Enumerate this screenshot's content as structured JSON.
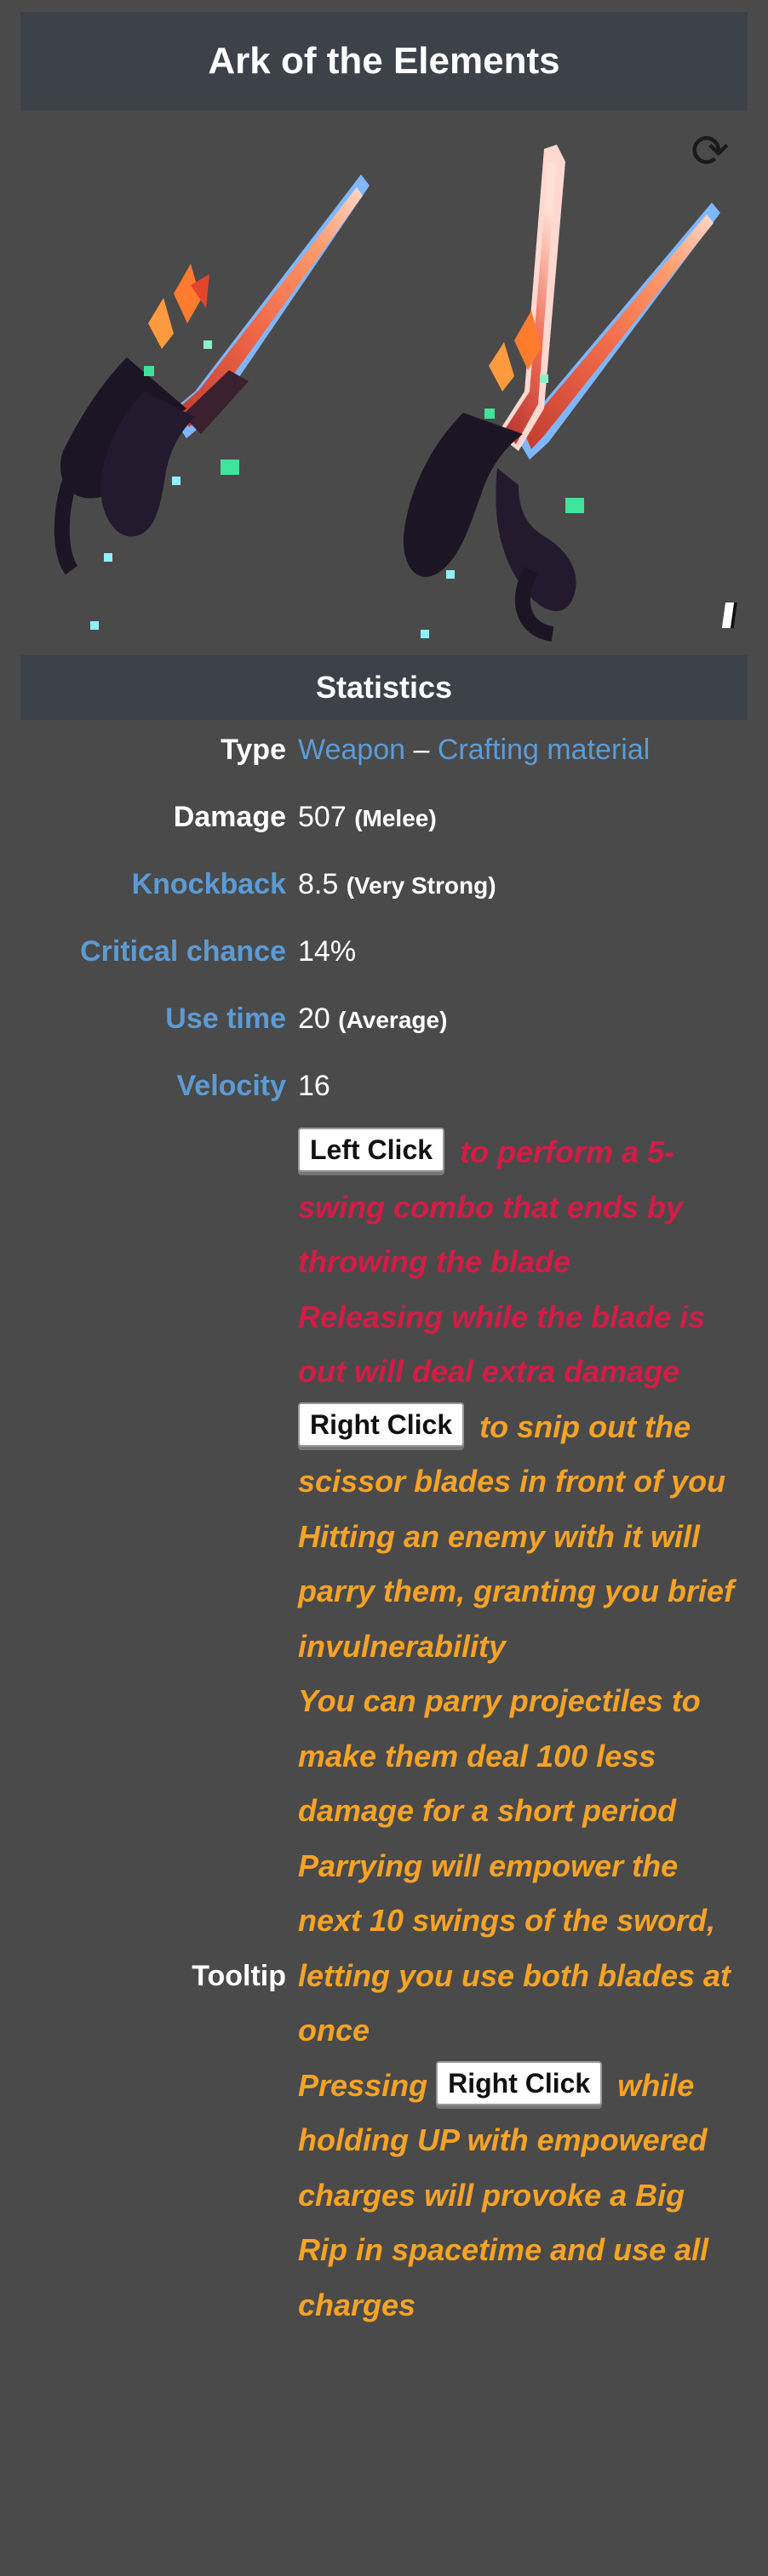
{
  "title": "Ark of the Elements",
  "image": {
    "refresh_icon": "refresh-icon",
    "item_alt": "Ark of the Elements sprite",
    "variants": [
      "closed",
      "open"
    ],
    "colors": {
      "blade_red": "#e24a3b",
      "blade_edge": "#8fc3ff",
      "handle_dark": "#1c1624",
      "gem_green": "#3fe39a",
      "flame_orange": "#ff7b2e"
    }
  },
  "section": "Statistics",
  "stats": {
    "type": {
      "label": "Type",
      "weapon": "Weapon",
      "separator": "–",
      "material": "Crafting material"
    },
    "damage": {
      "label": "Damage",
      "value": "507",
      "note": "(Melee)"
    },
    "knockback": {
      "label": "Knockback",
      "value": "8.5",
      "note": "(Very Strong)"
    },
    "critical": {
      "label": "Critical chance",
      "value": "14%"
    },
    "use_time": {
      "label": "Use time",
      "value": "20",
      "note": "(Average)"
    },
    "velocity": {
      "label": "Velocity",
      "value": "16"
    }
  },
  "tooltip": {
    "label": "Tooltip",
    "left_click": "Left Click",
    "red_line1": "to perform a 5-swing combo that ends by throwing the blade",
    "red_line2": "Releasing while the blade is out will deal extra damage",
    "right_click": "Right Click",
    "orange_line1": "to snip out the scissor blades in front of you",
    "orange_line2": "Hitting an enemy with it will parry them, granting you brief invulnerability",
    "orange_line3": "You can parry projectiles to make them deal 100 less damage for a short period",
    "orange_line4": "Parrying will empower the next 10 swings of the sword, letting you use both blades at once",
    "pressing": "Pressing",
    "right_click2": "Right Click",
    "orange_line5": "while holding UP with empowered charges will provoke a Big Rip in spacetime and use all charges"
  },
  "colors": {
    "panel": "#4a4a4a",
    "header": "#3d4148",
    "link": "#5b9bd5",
    "red_text": "#d31c45",
    "orange_text": "#f6a326"
  }
}
